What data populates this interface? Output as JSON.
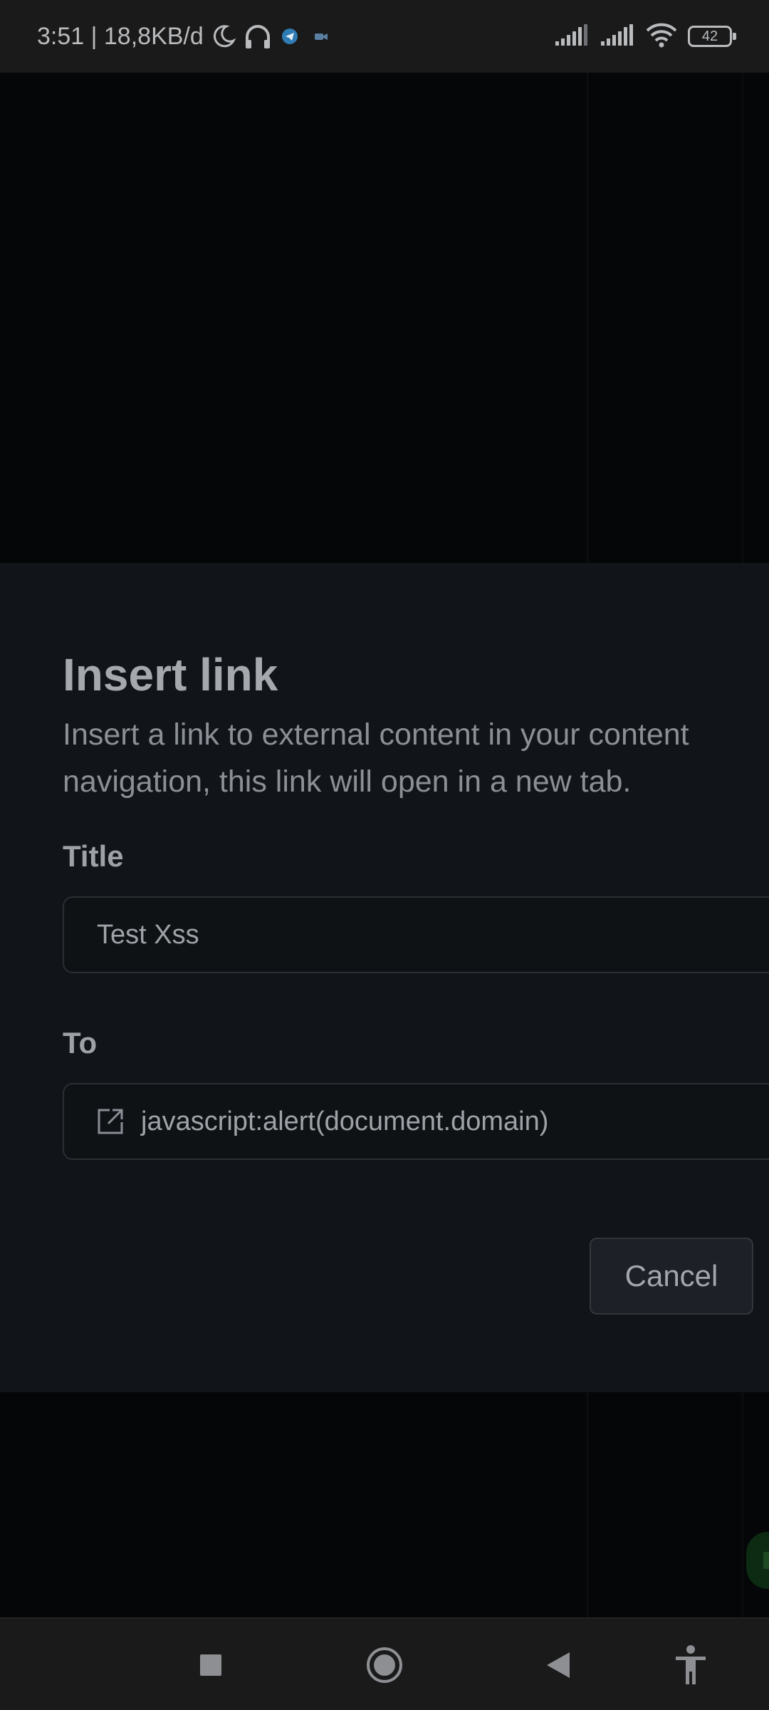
{
  "status_bar": {
    "time_and_speed": "3:51 | 18,8KB/d",
    "battery_level": "42",
    "icons": [
      "moon-icon",
      "headset-icon",
      "telegram-icon",
      "video-icon",
      "signal-icon",
      "signal-icon",
      "wifi-icon",
      "battery-icon"
    ]
  },
  "dialog": {
    "title": "Insert link",
    "description": "Insert a link to external content in your content navigation, this link will open in a new tab.",
    "title_field": {
      "label": "Title",
      "value": "Test Xss"
    },
    "to_field": {
      "label": "To",
      "value": "javascript:alert(document.domain)",
      "icon": "external-link-icon"
    },
    "cancel_label": "Cancel"
  },
  "nav_bar": {
    "icons": [
      "recents-square-icon",
      "home-circle-icon",
      "back-triangle-icon",
      "accessibility-icon"
    ]
  },
  "colors": {
    "dialog_bg": "#111418",
    "backdrop": "#050608",
    "text_primary": "#a5a9ae",
    "field_border": "#2b2f35"
  }
}
